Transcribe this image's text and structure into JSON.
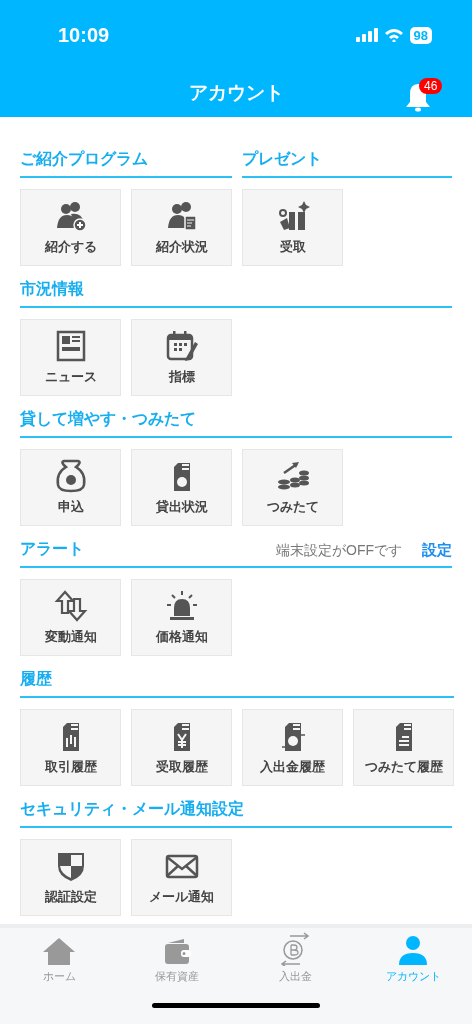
{
  "status_bar": {
    "time": "10:09",
    "battery": "98"
  },
  "header": {
    "title": "アカウント",
    "notification_count": "46"
  },
  "rows": [
    {
      "sections": [
        {
          "title": "ご紹介プログラム",
          "tiles": [
            {
              "label": "紹介する"
            },
            {
              "label": "紹介状況"
            }
          ]
        },
        {
          "title": "プレゼント",
          "tiles": [
            {
              "label": "受取"
            }
          ]
        }
      ]
    },
    {
      "sections": [
        {
          "title": "市況情報",
          "tiles": [
            {
              "label": "ニュース"
            },
            {
              "label": "指標"
            }
          ]
        }
      ]
    },
    {
      "sections": [
        {
          "title": "貸して増やす・つみたて",
          "tiles": [
            {
              "label": "申込"
            },
            {
              "label": "貸出状況"
            },
            {
              "label": "つみたて"
            }
          ]
        }
      ]
    },
    {
      "sections": [
        {
          "title": "アラート",
          "note": "端末設定がOFFです",
          "link": "設定",
          "tiles": [
            {
              "label": "変動通知"
            },
            {
              "label": "価格通知"
            }
          ]
        }
      ]
    },
    {
      "sections": [
        {
          "title": "履歴",
          "tiles": [
            {
              "label": "取引履歴"
            },
            {
              "label": "受取履歴"
            },
            {
              "label": "入出金履歴"
            },
            {
              "label": "つみたて履歴"
            }
          ]
        }
      ]
    },
    {
      "sections": [
        {
          "title": "セキュリティ・メール通知設定",
          "tiles": [
            {
              "label": "認証設定"
            },
            {
              "label": "メール通知"
            }
          ]
        }
      ]
    }
  ],
  "tab_bar": [
    {
      "label": "ホーム",
      "selected": false
    },
    {
      "label": "保有資産",
      "selected": false
    },
    {
      "label": "入出金",
      "selected": false
    },
    {
      "label": "アカウント",
      "selected": true
    }
  ]
}
